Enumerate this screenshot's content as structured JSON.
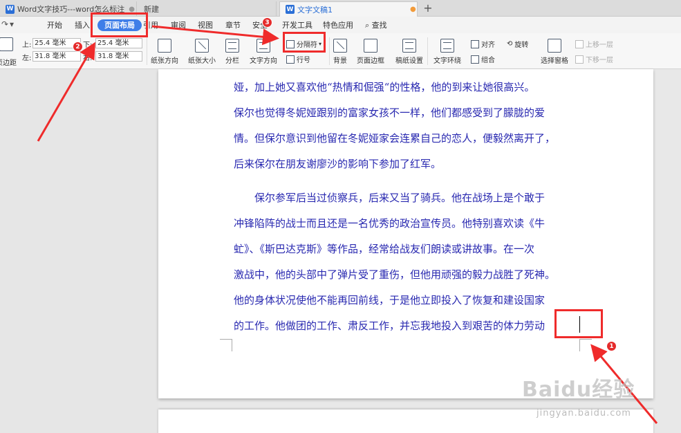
{
  "tabs": [
    {
      "label": "Word文字技巧---word怎么标注",
      "icon": "W"
    },
    {
      "label": "新建"
    },
    {
      "label": "文字文稿1",
      "icon": "W"
    }
  ],
  "menu": [
    "开始",
    "插入",
    "页面布局",
    "引用",
    "审阅",
    "视图",
    "章节",
    "安全",
    "开发工具",
    "特色应用",
    "查找"
  ],
  "ribbon": {
    "margins": {
      "top_label": "上:",
      "top": "25.4 毫米",
      "bottom_label": "下:",
      "bottom": "25.4 毫米",
      "left_label": "左:",
      "left": "31.8 毫米",
      "right_label": "右:",
      "right": "31.8 毫米",
      "margins_label": "页边距"
    },
    "orientation": "纸张方向",
    "size": "纸张大小",
    "columns": "分栏",
    "text_direction": "文字方向",
    "separator": "分隔符",
    "line_number": "行号",
    "background": "背景",
    "page_border": "页面边框",
    "paper_setting": "稿纸设置",
    "text_wrap": "文字环绕",
    "align": "对齐",
    "rotate": "旋转",
    "group": "组合",
    "selection_pane": "选择窗格",
    "bring_forward": "上移一层",
    "send_backward": "下移一层"
  },
  "document": {
    "paragraphs": [
      [
        "娅，加上她又喜欢他“热情和倔强“的性格，他的到来让她很高兴。",
        "保尔也觉得冬妮娅跟别的富家女孩不一样，他们都感受到了朦胧的爱",
        "情。但保尔意识到他留在冬妮娅家会连累自己的恋人，便毅然离开了，",
        "后来保尔在朋友谢廖沙的影响下参加了红军。"
      ],
      [
        "　　保尔参军后当过侦察兵，后来又当了骑兵。他在战场上是个敢于",
        "冲锋陷阵的战士而且还是一名优秀的政治宣传员。他特别喜欢读《牛",
        "虻》、《斯巴达克斯》等作品，经常给战友们朗读或讲故事。在一次",
        "激战中，他的头部中了弹片受了重伤，但他用顽强的毅力战胜了死神。",
        "他的身体状况使他不能再回前线，于是他立即投入了恢复和建设国家",
        "的工作。他做团的工作、肃反工作，并忘我地投入到艰苦的体力劳动"
      ]
    ]
  },
  "annotations": {
    "badge1": "1",
    "badge2": "2",
    "badge3": "3"
  },
  "watermark": {
    "logo": "Baidu经验",
    "url": "jingyan.baidu.com"
  },
  "colors": {
    "accent": "#3f7ee8",
    "annotation": "#ef2b2b",
    "doc_text": "#2828b0"
  }
}
